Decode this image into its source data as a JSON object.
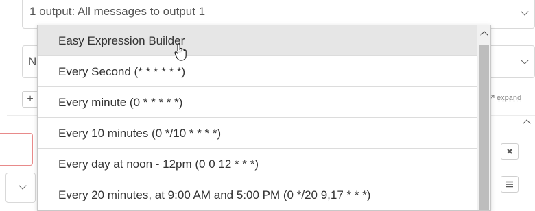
{
  "output_select": {
    "value": "1 output: All messages to output 1"
  },
  "second_select": {
    "value_partial": "N"
  },
  "add_button": {
    "label": "+"
  },
  "expand_link": {
    "icon": "expand-arrow-icon",
    "label": "expand"
  },
  "dropdown": {
    "items": [
      {
        "label": "Easy Expression Builder",
        "active": true
      },
      {
        "label": "Every Second (* * * * * *)"
      },
      {
        "label": "Every minute (0 * * * * *)"
      },
      {
        "label": "Every 10 minutes (0 */10 * * * *)"
      },
      {
        "label": "Every day at noon - 12pm (0 0 12 * * *)"
      },
      {
        "label": "Every 20 minutes, at 9:00 AM and 5:00 PM (0 */20 9,17 * * *)"
      }
    ]
  },
  "side_buttons": {
    "remove_icon": "close-icon",
    "menu_icon": "hamburger-icon"
  },
  "colors": {
    "active_item": "#e6e6e6",
    "error_border": "#e88a8a",
    "border": "#d9d9d9"
  }
}
